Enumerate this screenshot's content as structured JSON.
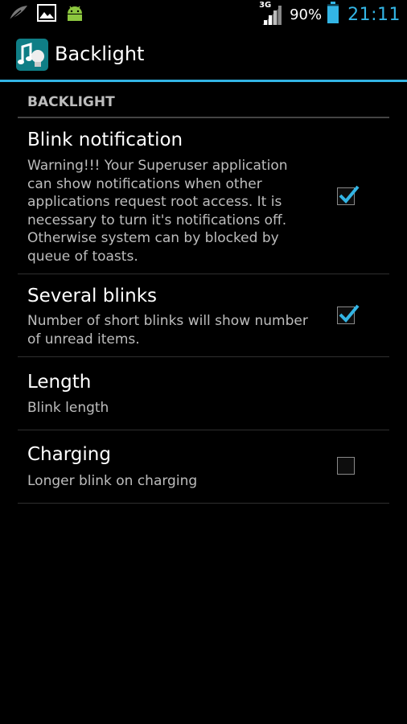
{
  "status_bar": {
    "left_icons": [
      "feather-icon",
      "image-icon",
      "android-icon"
    ],
    "network_label": "3G",
    "battery_percent": "90%",
    "battery_level": 0.9,
    "time": "21:11",
    "accent_color": "#33b5e5"
  },
  "action_bar": {
    "app_icon": "music-lightbulb-icon",
    "title": "Backlight"
  },
  "section": {
    "header": "BACKLIGHT"
  },
  "preferences": [
    {
      "title": "Blink notification",
      "summary": "Warning!!! Your Superuser application can show notifications when other applications request root access. It is necessary to turn it's notifications off. Otherwise system can by blocked by queue of toasts.",
      "checkbox": true,
      "checked": true
    },
    {
      "title": "Several blinks",
      "summary": "Number of short blinks will show number of unread items.",
      "checkbox": true,
      "checked": true
    },
    {
      "title": "Length",
      "summary": "Blink length",
      "checkbox": false,
      "checked": false
    },
    {
      "title": "Charging",
      "summary": "Longer blink on charging",
      "checkbox": true,
      "checked": false
    }
  ]
}
